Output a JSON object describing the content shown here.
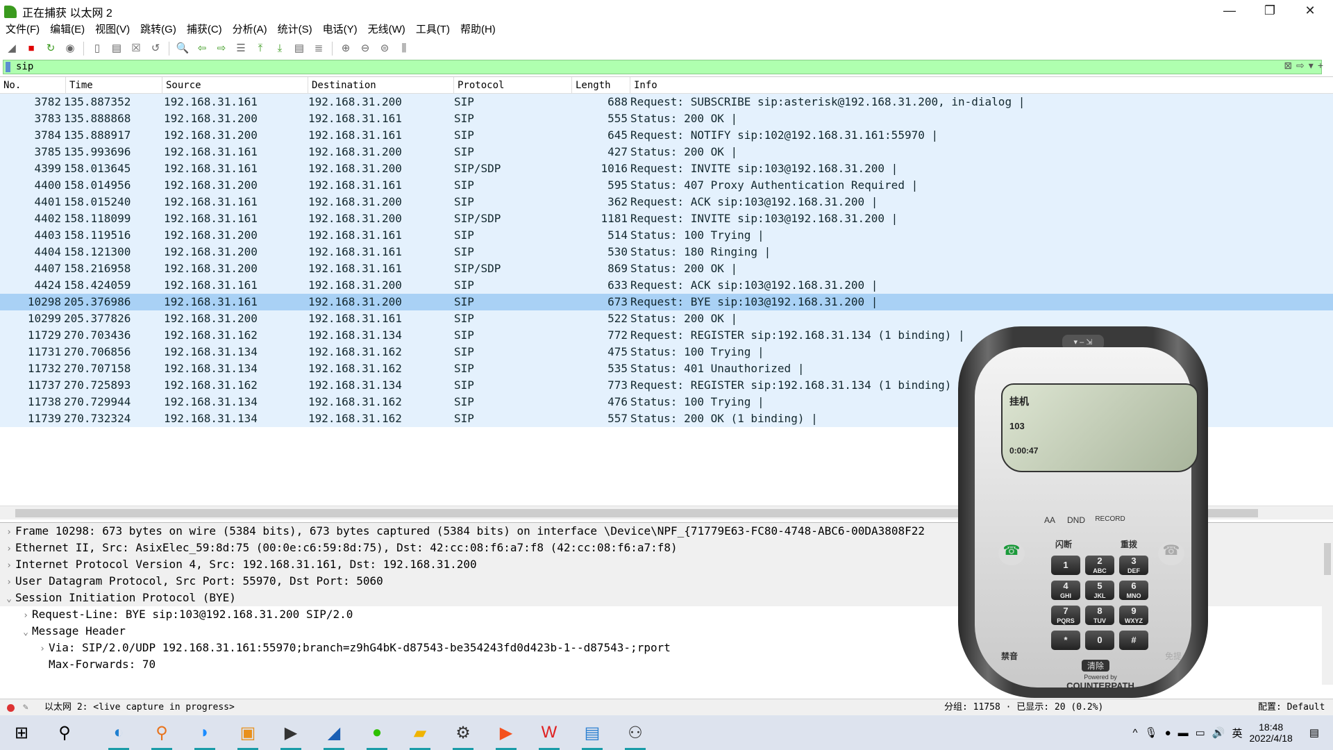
{
  "window": {
    "title": "正在捕获 以太网 2",
    "minimize": "—",
    "restore": "❐",
    "close": "✕"
  },
  "menu": [
    "文件(F)",
    "编辑(E)",
    "视图(V)",
    "跳转(G)",
    "捕获(C)",
    "分析(A)",
    "统计(S)",
    "电话(Y)",
    "无线(W)",
    "工具(T)",
    "帮助(H)"
  ],
  "toolbar": [
    {
      "name": "start-capture-icon",
      "glyph": "◢"
    },
    {
      "name": "stop-capture-icon",
      "glyph": "■",
      "color": "#e00000"
    },
    {
      "name": "restart-capture-icon",
      "glyph": "↻",
      "color": "#3a9a1e"
    },
    {
      "name": "capture-options-icon",
      "glyph": "◉"
    },
    {
      "name": "open-file-icon",
      "glyph": "▯"
    },
    {
      "name": "save-file-icon",
      "glyph": "▤"
    },
    {
      "name": "close-file-icon",
      "glyph": "☒"
    },
    {
      "name": "reload-file-icon",
      "glyph": "↺"
    },
    {
      "name": "find-packet-icon",
      "glyph": "🔍"
    },
    {
      "name": "go-back-icon",
      "glyph": "⇦",
      "color": "#3a9a1e"
    },
    {
      "name": "go-forward-icon",
      "glyph": "⇨",
      "color": "#3a9a1e"
    },
    {
      "name": "go-to-packet-icon",
      "glyph": "☰"
    },
    {
      "name": "first-packet-icon",
      "glyph": "⤒",
      "color": "#3a9a1e"
    },
    {
      "name": "last-packet-icon",
      "glyph": "⤓",
      "color": "#3a9a1e"
    },
    {
      "name": "autoscroll-icon",
      "glyph": "▤"
    },
    {
      "name": "colorize-icon",
      "glyph": "≣"
    },
    {
      "name": "zoom-in-icon",
      "glyph": "⊕"
    },
    {
      "name": "zoom-out-icon",
      "glyph": "⊖"
    },
    {
      "name": "zoom-normal-icon",
      "glyph": "⊜"
    },
    {
      "name": "resize-columns-icon",
      "glyph": "⫼"
    }
  ],
  "filter": {
    "value": "sip",
    "clear": "⊠",
    "apply": "⇨",
    "dropdown": "▾",
    "add": "+"
  },
  "columns": [
    "No.",
    "Time",
    "Source",
    "Destination",
    "Protocol",
    "Length",
    "Info"
  ],
  "packets": [
    [
      "3782",
      "135.887352",
      "192.168.31.161",
      "192.168.31.200",
      "SIP",
      "688",
      "Request: SUBSCRIBE sip:asterisk@192.168.31.200, in-dialog |"
    ],
    [
      "3783",
      "135.888868",
      "192.168.31.200",
      "192.168.31.161",
      "SIP",
      "555",
      "Status: 200 OK |"
    ],
    [
      "3784",
      "135.888917",
      "192.168.31.200",
      "192.168.31.161",
      "SIP",
      "645",
      "Request: NOTIFY sip:102@192.168.31.161:55970 |"
    ],
    [
      "3785",
      "135.993696",
      "192.168.31.161",
      "192.168.31.200",
      "SIP",
      "427",
      "Status: 200 OK |"
    ],
    [
      "4399",
      "158.013645",
      "192.168.31.161",
      "192.168.31.200",
      "SIP/SDP",
      "1016",
      "Request: INVITE sip:103@192.168.31.200 |"
    ],
    [
      "4400",
      "158.014956",
      "192.168.31.200",
      "192.168.31.161",
      "SIP",
      "595",
      "Status: 407 Proxy Authentication Required |"
    ],
    [
      "4401",
      "158.015240",
      "192.168.31.161",
      "192.168.31.200",
      "SIP",
      "362",
      "Request: ACK sip:103@192.168.31.200 |"
    ],
    [
      "4402",
      "158.118099",
      "192.168.31.161",
      "192.168.31.200",
      "SIP/SDP",
      "1181",
      "Request: INVITE sip:103@192.168.31.200 |"
    ],
    [
      "4403",
      "158.119516",
      "192.168.31.200",
      "192.168.31.161",
      "SIP",
      "514",
      "Status: 100 Trying |"
    ],
    [
      "4404",
      "158.121300",
      "192.168.31.200",
      "192.168.31.161",
      "SIP",
      "530",
      "Status: 180 Ringing |"
    ],
    [
      "4407",
      "158.216958",
      "192.168.31.200",
      "192.168.31.161",
      "SIP/SDP",
      "869",
      "Status: 200 OK |"
    ],
    [
      "4424",
      "158.424059",
      "192.168.31.161",
      "192.168.31.200",
      "SIP",
      "633",
      "Request: ACK sip:103@192.168.31.200 |"
    ],
    [
      "10298",
      "205.376986",
      "192.168.31.161",
      "192.168.31.200",
      "SIP",
      "673",
      "Request: BYE sip:103@192.168.31.200 |"
    ],
    [
      "10299",
      "205.377826",
      "192.168.31.200",
      "192.168.31.161",
      "SIP",
      "522",
      "Status: 200 OK |"
    ],
    [
      "11729",
      "270.703436",
      "192.168.31.162",
      "192.168.31.134",
      "SIP",
      "772",
      "Request: REGISTER sip:192.168.31.134  (1 binding) |"
    ],
    [
      "11731",
      "270.706856",
      "192.168.31.134",
      "192.168.31.162",
      "SIP",
      "475",
      "Status: 100 Trying |"
    ],
    [
      "11732",
      "270.707158",
      "192.168.31.134",
      "192.168.31.162",
      "SIP",
      "535",
      "Status: 401 Unauthorized |"
    ],
    [
      "11737",
      "270.725893",
      "192.168.31.162",
      "192.168.31.134",
      "SIP",
      "773",
      "Request: REGISTER sip:192.168.31.134  (1 binding) |"
    ],
    [
      "11738",
      "270.729944",
      "192.168.31.134",
      "192.168.31.162",
      "SIP",
      "476",
      "Status: 100 Trying |"
    ],
    [
      "11739",
      "270.732324",
      "192.168.31.134",
      "192.168.31.162",
      "SIP",
      "557",
      "Status: 200 OK  (1 binding) |"
    ]
  ],
  "selected_packet": "10298",
  "details": [
    {
      "text": "Frame 10298: 673 bytes on wire (5384 bits), 673 bytes captured (5384 bits) on interface \\Device\\NPF_{71779E63-FC80-4748-ABC6-00DA3808F22",
      "level": 0,
      "state": "collapsed"
    },
    {
      "text": "Ethernet II, Src: AsixElec_59:8d:75 (00:0e:c6:59:8d:75), Dst: 42:cc:08:f6:a7:f8 (42:cc:08:f6:a7:f8)",
      "level": 0,
      "state": "collapsed"
    },
    {
      "text": "Internet Protocol Version 4, Src: 192.168.31.161, Dst: 192.168.31.200",
      "level": 0,
      "state": "collapsed"
    },
    {
      "text": "User Datagram Protocol, Src Port: 55970, Dst Port: 5060",
      "level": 0,
      "state": "collapsed"
    },
    {
      "text": "Session Initiation Protocol (BYE)",
      "level": 0,
      "state": "expanded"
    },
    {
      "text": "Request-Line: BYE sip:103@192.168.31.200 SIP/2.0",
      "level": 1,
      "state": "collapsed"
    },
    {
      "text": "Message Header",
      "level": 1,
      "state": "expanded"
    },
    {
      "text": "Via: SIP/2.0/UDP 192.168.31.161:55970;branch=z9hG4bK-d87543-be354243fd0d423b-1--d87543-;rport",
      "level": 2,
      "state": "collapsed"
    },
    {
      "text": "Max-Forwards: 70",
      "level": 2,
      "state": "leaf"
    }
  ],
  "status": {
    "interface": "以太网 2: <live capture in progress>",
    "packets": "分组: 11758 · 已显示: 20 (0.2%)",
    "profile": "配置: Default"
  },
  "phone": {
    "status": "挂机",
    "number": "103",
    "timer": "0:00:47",
    "buttons": {
      "aa": "AA",
      "dnd": "DND",
      "record": "RECORD",
      "flash": "闪断",
      "redial": "重拨",
      "mute": "禁音",
      "speaker": "免提",
      "clear": "清除"
    },
    "keys": [
      [
        "1",
        ""
      ],
      [
        "2",
        "ABC"
      ],
      [
        "3",
        "DEF"
      ],
      [
        "4",
        "GHI"
      ],
      [
        "5",
        "JKL"
      ],
      [
        "6",
        "MNO"
      ],
      [
        "7",
        "PQRS"
      ],
      [
        "8",
        "TUV"
      ],
      [
        "9",
        "WXYZ"
      ],
      [
        "*",
        ""
      ],
      [
        "0",
        ""
      ],
      [
        "#",
        ""
      ]
    ],
    "brand_small": "Powered by",
    "brand": "COUNTERPATH"
  },
  "taskbar": {
    "apps": [
      {
        "name": "start-icon",
        "glyph": "⊞"
      },
      {
        "name": "search-icon",
        "glyph": "⚲"
      },
      {
        "name": "edge-icon",
        "glyph": "◐",
        "color": "#1f7fd0",
        "run": true
      },
      {
        "name": "search-app-icon",
        "glyph": "⚲",
        "color": "#e8731c",
        "run": true
      },
      {
        "name": "app-icon",
        "glyph": "◗",
        "color": "#1a8cff",
        "run": true
      },
      {
        "name": "app-icon",
        "glyph": "▣",
        "color": "#e8901c",
        "run": true
      },
      {
        "name": "terminal-icon",
        "glyph": "▶",
        "color": "#333",
        "run": true
      },
      {
        "name": "wireshark-icon",
        "glyph": "◢",
        "color": "#1a5fb4",
        "run": true
      },
      {
        "name": "wechat-icon",
        "glyph": "●",
        "color": "#2dc100",
        "run": true
      },
      {
        "name": "explorer-icon",
        "glyph": "▰",
        "color": "#f0b400",
        "run": true
      },
      {
        "name": "settings-icon",
        "glyph": "⚙",
        "color": "#333",
        "run": true
      },
      {
        "name": "app-icon",
        "glyph": "▶",
        "color": "#f4511e",
        "run": true
      },
      {
        "name": "wps-icon",
        "glyph": "W",
        "color": "#e02020",
        "run": true
      },
      {
        "name": "app-icon",
        "glyph": "▤",
        "color": "#2a7fd0",
        "run": true
      },
      {
        "name": "phone-app-icon",
        "glyph": "⚇",
        "color": "#333",
        "run": true
      }
    ],
    "tray": {
      "chevron": "^",
      "ime": "英",
      "time": "18:48",
      "date": "2022/4/18"
    }
  }
}
